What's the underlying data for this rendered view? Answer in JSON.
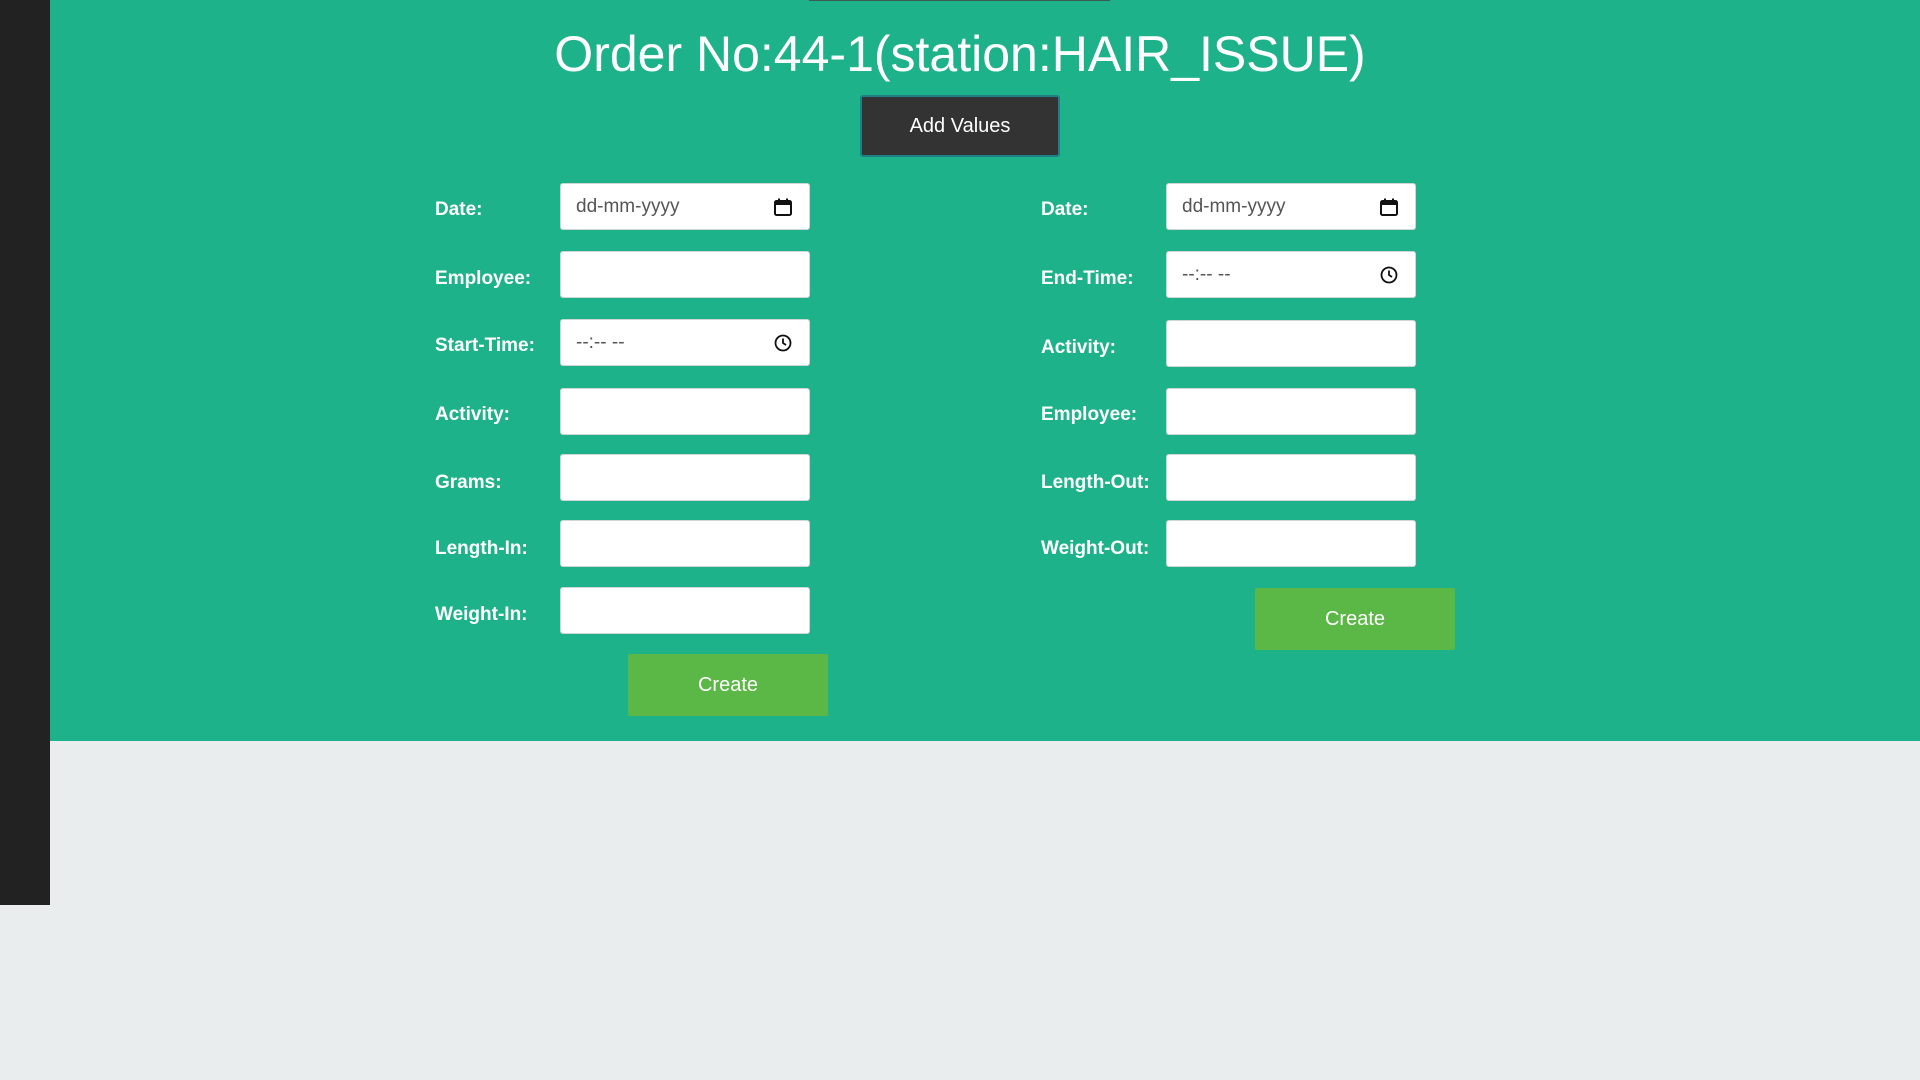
{
  "header": {
    "title": "Order No:44-1(station:HAIR_ISSUE)",
    "add_values_label": "Add Values"
  },
  "left_form": {
    "date_label": "Date:",
    "date_placeholder": "dd-mm-yyyy",
    "employee_label": "Employee:",
    "start_time_label": "Start-Time:",
    "start_time_placeholder": "--:-- --",
    "activity_label": "Activity:",
    "grams_label": "Grams:",
    "length_in_label": "Length-In:",
    "weight_in_label": "Weight-In:",
    "create_label": "Create"
  },
  "right_form": {
    "date_label": "Date:",
    "date_placeholder": "dd-mm-yyyy",
    "end_time_label": "End-Time:",
    "end_time_placeholder": "--:-- --",
    "activity_label": "Activity:",
    "employee_label": "Employee:",
    "length_out_label": "Length-Out:",
    "weight_out_label": "Weight-Out:",
    "create_label": "Create"
  },
  "colors": {
    "panel": "#1db289",
    "sidebar": "#222222",
    "dark_button": "#333333",
    "create_button": "#5bb846",
    "page_background": "#e9edee"
  },
  "icons": {
    "date": "calendar-icon",
    "time": "clock-icon"
  }
}
